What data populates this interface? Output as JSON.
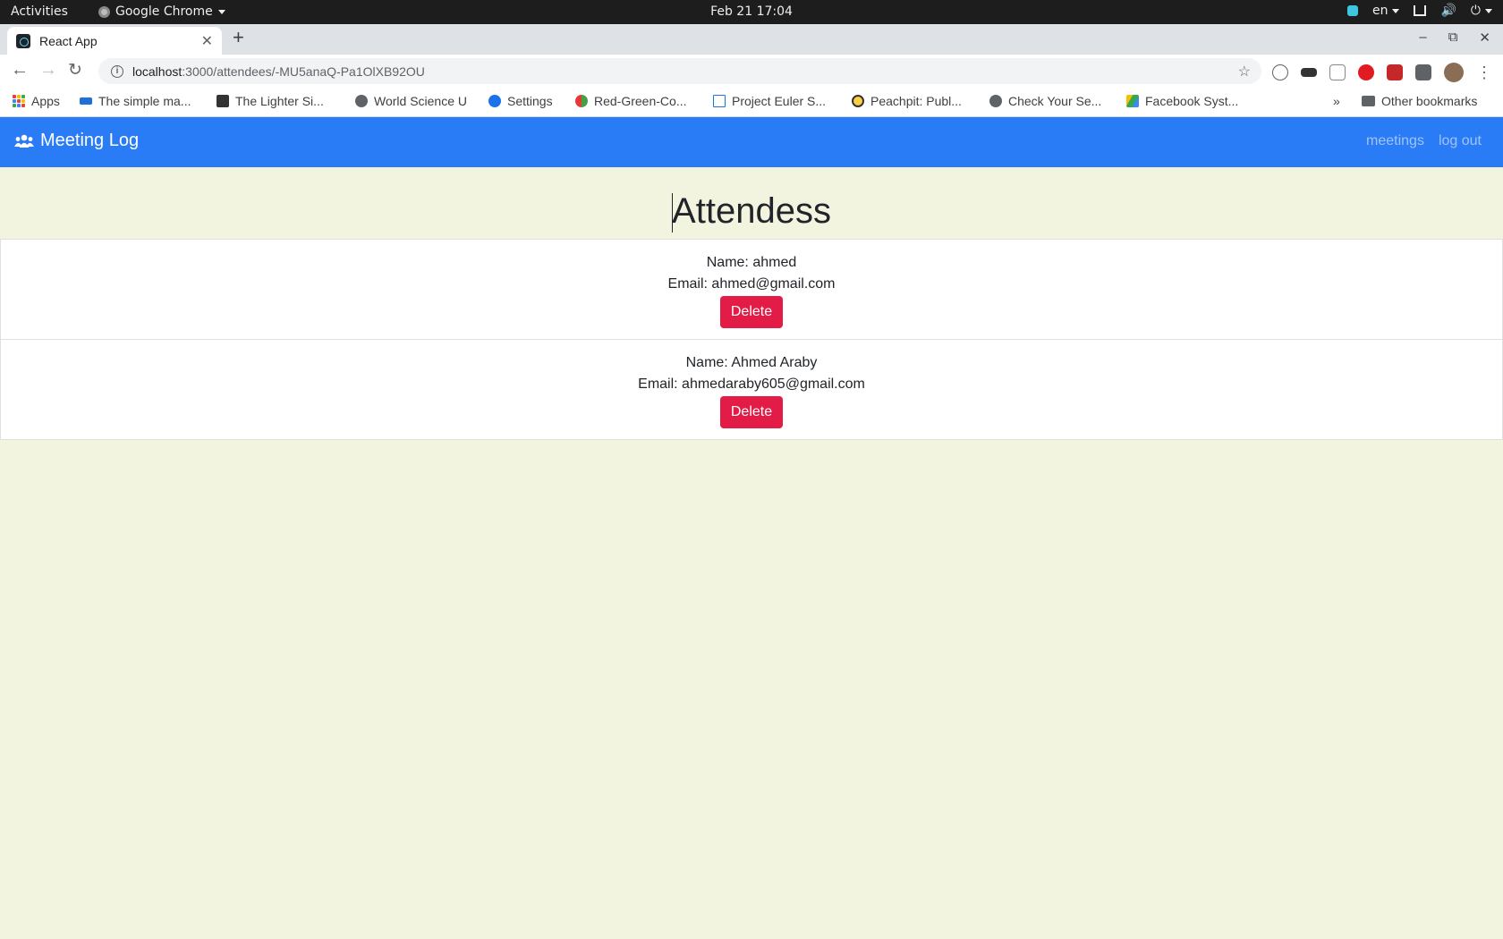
{
  "system_bar": {
    "activities": "Activities",
    "app_name": "Google Chrome",
    "clock": "Feb 21  17:04",
    "language": "en"
  },
  "browser": {
    "tab_title": "React App",
    "url_host": "localhost",
    "url_path": ":3000/attendees/-MU5anaQ-Pa1OlXB92OU",
    "bookmarks": [
      {
        "label": "Apps",
        "icon": "apps-grid-icon"
      },
      {
        "label": "The simple ma...",
        "icon": "bookmark-favicon"
      },
      {
        "label": "The Lighter Si...",
        "icon": "rocket-icon"
      },
      {
        "label": "World Science U",
        "icon": "globe-icon"
      },
      {
        "label": "Settings",
        "icon": "gear-icon"
      },
      {
        "label": "Red-Green-Co...",
        "icon": "bookmark-favicon"
      },
      {
        "label": "Project Euler S...",
        "icon": "bookmark-favicon"
      },
      {
        "label": "Peachpit: Publ...",
        "icon": "bookmark-favicon"
      },
      {
        "label": "Check Your Se...",
        "icon": "globe-icon"
      },
      {
        "label": "Facebook Syst...",
        "icon": "drive-icon"
      }
    ],
    "overflow": "»",
    "other_bookmarks": "Other bookmarks"
  },
  "navbar": {
    "brand": "Meeting Log",
    "links": [
      "meetings",
      "log out"
    ],
    "color": "#2a7bf6"
  },
  "page": {
    "title": "Attendess",
    "attendees": [
      {
        "name_line": "Name: ahmed",
        "email_line": "Email: ahmed@gmail.com",
        "delete_label": "Delete"
      },
      {
        "name_line": "Name: Ahmed Araby",
        "email_line": "Email: ahmedaraby605@gmail.com",
        "delete_label": "Delete"
      }
    ],
    "background": "#f2f4df",
    "delete_color": "#e31c47"
  }
}
